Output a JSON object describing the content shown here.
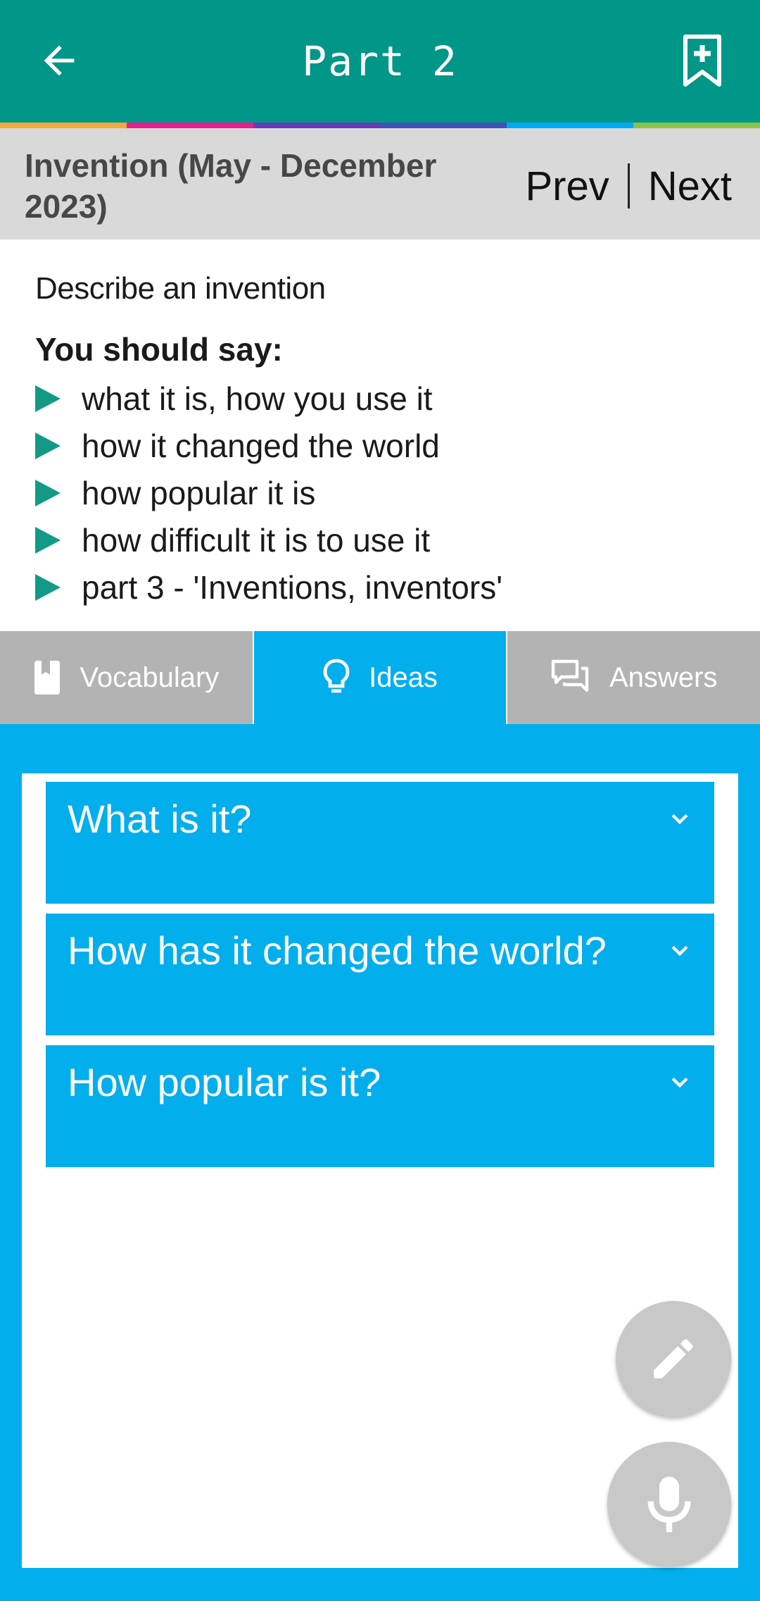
{
  "app_bar": {
    "title": "Part 2",
    "back_icon": "arrow-left-icon",
    "bookmark_icon": "bookmark-add-icon",
    "background": "#009688"
  },
  "accent_stripe": [
    "#f2a93b",
    "#e91e8c",
    "#673ab7",
    "#3f51b5",
    "#03a9f4",
    "#8bc34a"
  ],
  "topic": {
    "title": "Invention (May - December 2023)",
    "prev_label": "Prev",
    "next_label": "Next"
  },
  "prompt": {
    "intro": "Describe an invention",
    "should_say": "You should say:",
    "points": [
      "what it is, how you use it",
      "how it changed the world",
      "how popular it is",
      "how difficult it is to use it",
      "part 3 - 'Inventions, inventors'"
    ]
  },
  "tabs": [
    {
      "label": "Vocabulary",
      "icon": "book-icon",
      "active": false
    },
    {
      "label": "Ideas",
      "icon": "lightbulb-icon",
      "active": true
    },
    {
      "label": "Answers",
      "icon": "chat-bubbles-icon",
      "active": false
    }
  ],
  "ideas": {
    "items": [
      {
        "question": "What is it?"
      },
      {
        "question": "How has it changed the world?"
      },
      {
        "question": "How popular is it?"
      }
    ],
    "expand_icon": "chevron-down-icon"
  },
  "fabs": {
    "edit_icon": "pencil-icon",
    "mic_icon": "microphone-icon"
  },
  "colors": {
    "accent_blue": "#03aeed",
    "tab_inactive": "#b3b3b3",
    "bullet": "#139a86"
  }
}
